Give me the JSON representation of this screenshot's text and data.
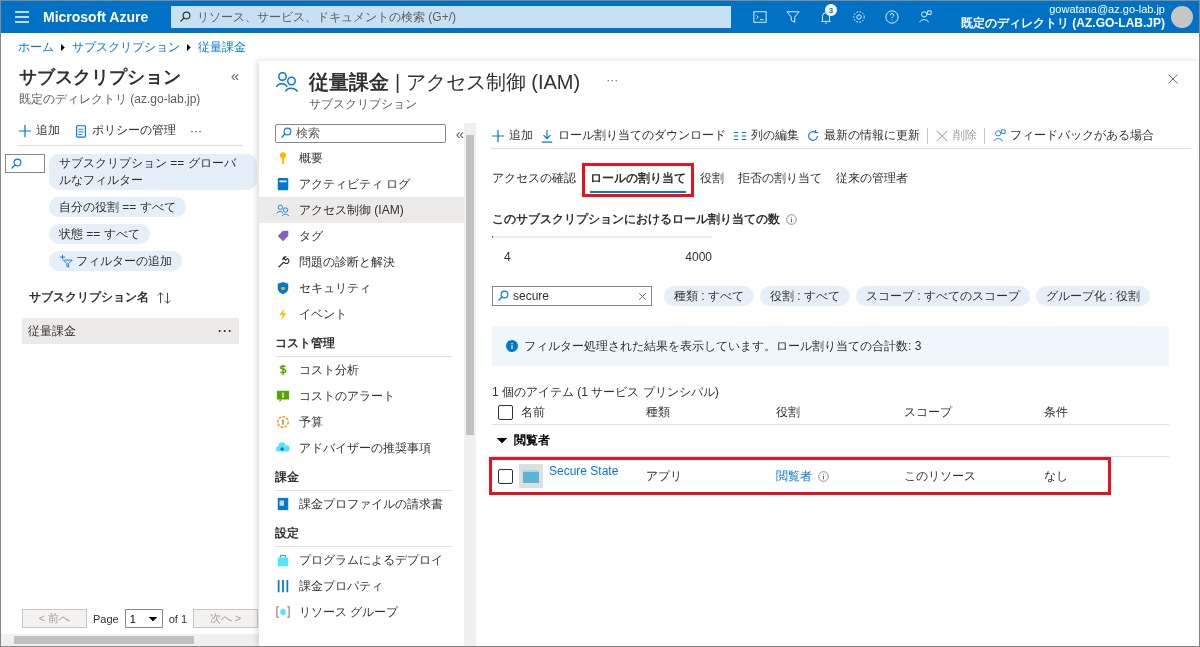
{
  "topbar": {
    "brand": "Microsoft Azure",
    "search_placeholder": "リソース、サービス、ドキュメントの検索 (G+/)",
    "notification_count": "3",
    "user": "gowatana@az.go-lab.jp",
    "directory": "既定のディレクトリ (AZ.GO-LAB.JP)"
  },
  "breadcrumb": [
    "ホーム",
    "サブスクリプション",
    "従量課金"
  ],
  "left": {
    "title": "サブスクリプション",
    "subtitle": "既定のディレクトリ (az.go-lab.jp)",
    "collapse": "«",
    "toolbar": [
      "追加",
      "ポリシーの管理"
    ],
    "more": "···",
    "filters": [
      {
        "kind": "filter",
        "label": "サブスクリプション == グローバルなフィルター"
      },
      {
        "kind": "filter",
        "label": "自分の役割 == すべて"
      },
      {
        "kind": "filter",
        "label": "状態 == すべて"
      },
      {
        "kind": "add",
        "label": "フィルターの追加"
      }
    ],
    "column": "サブスクリプション名",
    "rows": [
      {
        "name": "従量課金",
        "more": "···",
        "selected": true
      }
    ],
    "pager": {
      "prev": "< 前へ",
      "page_label": "Page",
      "page": "1",
      "of": "of 1",
      "next": "次へ >"
    }
  },
  "blade": {
    "title": "従量課金",
    "title_rest": "| アクセス制御 (IAM)",
    "subtitle": "サブスクリプション",
    "more": "···"
  },
  "menu": {
    "search_placeholder": "検索",
    "collapse": "«",
    "sections": [
      {
        "items": [
          {
            "label": "概要",
            "selected": false
          },
          {
            "label": "アクティビティ ログ",
            "selected": false
          },
          {
            "label": "アクセス制御 (IAM)",
            "selected": true
          },
          {
            "label": "タグ",
            "selected": false
          },
          {
            "label": "問題の診断と解決",
            "selected": false
          },
          {
            "label": "セキュリティ",
            "selected": false
          },
          {
            "label": "イベント",
            "selected": false
          }
        ]
      },
      {
        "heading": "コスト管理",
        "items": [
          {
            "label": "コスト分析",
            "selected": false
          },
          {
            "label": "コストのアラート",
            "selected": false
          },
          {
            "label": "予算",
            "selected": false
          },
          {
            "label": "アドバイザーの推奨事項",
            "selected": false
          }
        ]
      },
      {
        "heading": "課金",
        "items": [
          {
            "label": "課金プロファイルの請求書",
            "selected": false
          }
        ]
      },
      {
        "heading": "設定",
        "items": [
          {
            "label": "プログラムによるデプロイ",
            "selected": false
          },
          {
            "label": "課金プロパティ",
            "selected": false
          },
          {
            "label": "リソース グループ",
            "selected": false
          }
        ]
      }
    ]
  },
  "toolbar": [
    {
      "label": "追加",
      "disabled": false
    },
    {
      "label": "ロール割り当てのダウンロード",
      "disabled": false
    },
    {
      "label": "列の編集",
      "disabled": false
    },
    {
      "label": "最新の情報に更新",
      "disabled": false
    },
    {
      "label": "削除",
      "disabled": true
    },
    {
      "label": "フィードバックがある場合",
      "disabled": false
    }
  ],
  "tabs": [
    {
      "label": "アクセスの確認",
      "selected": false,
      "highlighted": false
    },
    {
      "label": "ロールの割り当て",
      "selected": true,
      "highlighted": true
    },
    {
      "label": "役割",
      "selected": false,
      "highlighted": false
    },
    {
      "label": "拒否の割り当て",
      "selected": false,
      "highlighted": false
    },
    {
      "label": "従来の管理者",
      "selected": false,
      "highlighted": false
    }
  ],
  "quota": {
    "label": "このサブスクリプションにおけるロール割り当ての数",
    "level": 0.001,
    "min": "4",
    "max": "4000"
  },
  "search": {
    "value": "secure"
  },
  "pills": [
    "種類 : すべて",
    "役割 : すべて",
    "スコープ : すべてのスコープ",
    "グループ化 : 役割"
  ],
  "info": "フィルター処理された結果を表示しています。ロール割り当ての合計数: 3",
  "count": "1 個のアイテム (1 サービス プリンシパル)",
  "columns": [
    "名前",
    "種類",
    "役割",
    "スコープ",
    "条件"
  ],
  "select_all_checked": false,
  "groups": [
    {
      "name": "閲覧者",
      "expanded": true,
      "rows": [
        {
          "name": "Secure State",
          "type": "アプリ",
          "role": "閲覧者",
          "scope": "このリソース",
          "condition": "なし",
          "checked": false,
          "highlighted": true
        }
      ]
    }
  ]
}
